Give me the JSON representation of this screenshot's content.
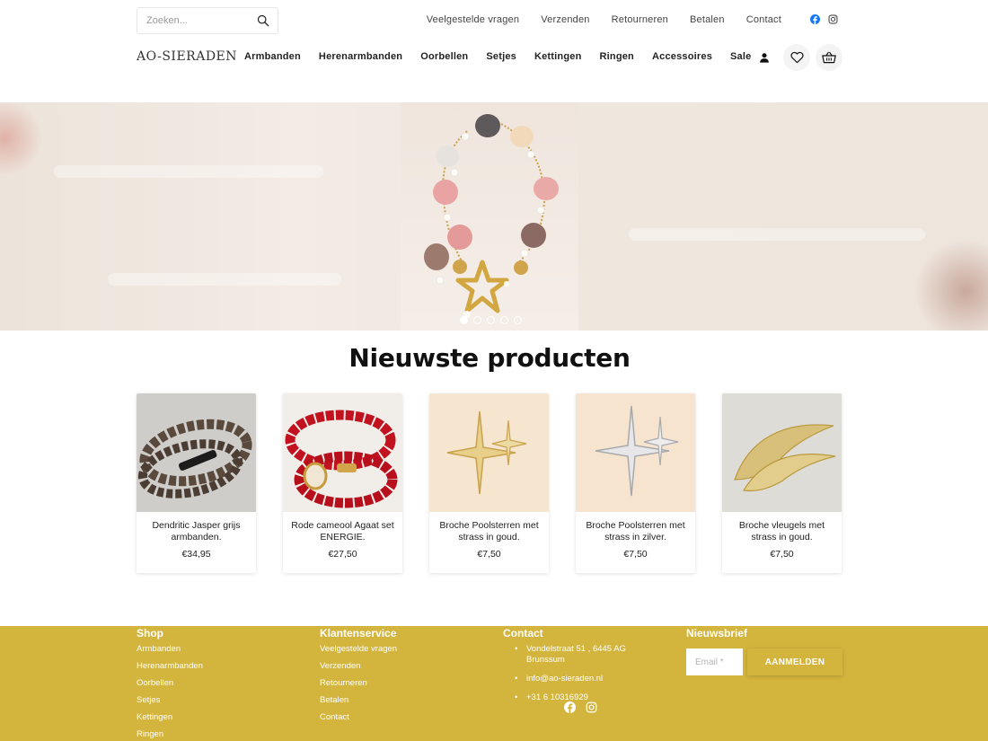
{
  "search": {
    "placeholder": "Zoeken..."
  },
  "top_links": [
    "Veelgestelde vragen",
    "Verzenden",
    "Retourneren",
    "Betalen",
    "Contact"
  ],
  "logo": "AO-SIERADEN",
  "nav": [
    "Armbanden",
    "Herenarmbanden",
    "Oorbellen",
    "Setjes",
    "Kettingen",
    "Ringen",
    "Accessoires",
    "Sale"
  ],
  "hero": {
    "slides": 5,
    "active_slide": 1
  },
  "section_title": "Nieuwste producten",
  "products": [
    {
      "title": "Dendritic Jasper grijs armbanden.",
      "price": "€34,95"
    },
    {
      "title": "Rode cameool Agaat set ENERGIE.",
      "price": "€27,50"
    },
    {
      "title": "Broche Poolsterren met strass in goud.",
      "price": "€7,50"
    },
    {
      "title": "Broche Poolsterren met strass in zilver.",
      "price": "€7,50"
    },
    {
      "title": "Broche vleugels met strass in goud.",
      "price": "€7,50"
    }
  ],
  "footer": {
    "shop": {
      "heading": "Shop",
      "links": [
        "Armbanden",
        "Herenarmbanden",
        "Oorbellen",
        "Setjes",
        "Kettingen",
        "Ringen"
      ]
    },
    "service": {
      "heading": "Klantenservice",
      "links": [
        "Veelgestelde vragen",
        "Verzenden",
        "Retourneren",
        "Betalen",
        "Contact"
      ]
    },
    "contact": {
      "heading": "Contact",
      "address": "Vondelstraat 51 , 6445 AG Brunssum",
      "email": "info@ao-sieraden.nl",
      "phone": "+31 6 10316929"
    },
    "newsletter": {
      "heading": "Nieuwsbrief",
      "email_placeholder": "Email *",
      "button": "AANMELDEN"
    }
  },
  "colors": {
    "footer_bg": "#d3b43c",
    "facebook": "#1877f2"
  },
  "icons": [
    "search-icon",
    "facebook-icon",
    "instagram-icon",
    "user-icon",
    "heart-icon",
    "basket-icon"
  ]
}
